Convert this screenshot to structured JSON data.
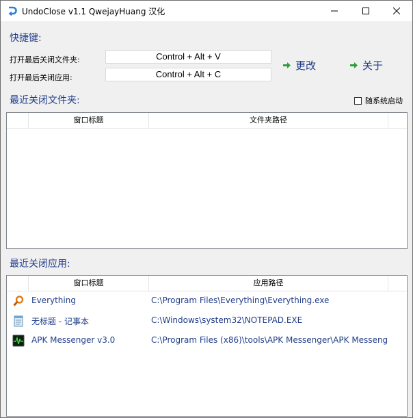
{
  "window": {
    "title": "UndoClose v1.1  QwejayHuang 汉化",
    "controls": [
      "minimize-icon",
      "maximize-icon",
      "close-icon"
    ]
  },
  "hotkeys": {
    "heading": "快捷键:",
    "folder_label": "打开最后关闭文件夹:",
    "folder_value": "Control + Alt + V",
    "app_label": "打开最后关闭应用:",
    "app_value": "Control + Alt + C",
    "change_label": "更改",
    "about_label": "关于"
  },
  "folders": {
    "heading": "最近关闭文件夹:",
    "follow_startup_label": "随系统启动",
    "follow_startup_checked": false,
    "columns": [
      "窗口标题",
      "文件夹路径"
    ],
    "rows": []
  },
  "apps": {
    "heading": "最近关闭应用:",
    "columns": [
      "窗口标题",
      "应用路径"
    ],
    "rows": [
      {
        "title": "Everything",
        "path": "C:\\Program Files\\Everything\\Everything.exe",
        "icon": "everything-icon"
      },
      {
        "title": "无标题 - 记事本",
        "path": "C:\\Windows\\system32\\NOTEPAD.EXE",
        "icon": "notepad-icon"
      },
      {
        "title": "APK Messenger v3.0",
        "path": "C:\\Program Files (x86)\\tools\\APK Messenger\\APK Messeng",
        "icon": "apk-messenger-icon"
      }
    ]
  },
  "colors": {
    "accent": "#1f3d8a",
    "window_bg": "#f0f0f0",
    "arrow_green": "#2e9e3a"
  }
}
